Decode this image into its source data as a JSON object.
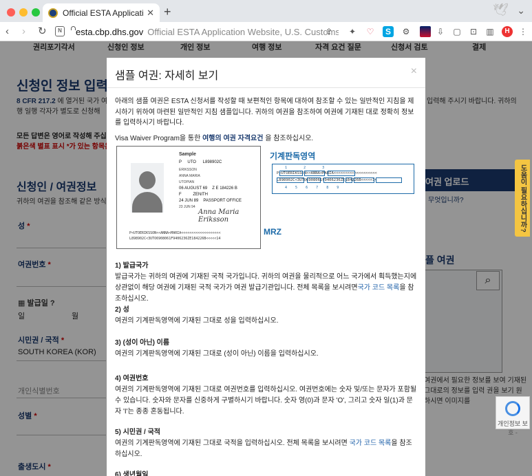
{
  "browser": {
    "tab_title": "Official ESTA Application Website",
    "tab_close": "✕",
    "new_tab": "+",
    "url_domain": "esta.cbp.dhs.gov",
    "url_title": "Official ESTA Application Website, U.S. Customs",
    "avatar_initial": "H",
    "icons": [
      "back-icon",
      "forward-icon",
      "reload-icon",
      "reader-icon",
      "lock-icon",
      "share-icon",
      "extensions-icon",
      "pocket-icon",
      "s-icon",
      "gear-icon",
      "flag-icon",
      "download-icon",
      "camera-icon",
      "screenshot-icon",
      "sidebar-icon",
      "profile-avatar",
      "more-icon"
    ]
  },
  "page": {
    "steps": [
      "권리포기각서",
      "신청인 정보",
      "개인 정보",
      "여행 정보",
      "자격 요건 질문",
      "신청서 검토",
      "결제"
    ],
    "title": "신청인 정보 입력",
    "cfr_prefix": "8 CFR 217.2",
    "cfr_text": "에 열거된 국가 여행 일행 각자가 별도로 신청해",
    "cfr_text_right": "입력해 주시기 바랍니다. 귀하의",
    "english_notice": "모든 답변은 영어로 작성해 주십시",
    "required_notice": "붉은색 별표 표시 *가 있는 항목은",
    "section_title": "신청인 / 여권정보",
    "section_note": "귀하의 여권을 참조해 같은 방식으",
    "fields": {
      "surname": "성",
      "passport_no": "여권번호",
      "issue_date": "발급일",
      "day": "일",
      "month": "월",
      "citizenship": "시민권 / 국적",
      "citizenship_value": "SOUTH KOREA (KOR)",
      "personal_id": "개인식별번호",
      "sex": "성별",
      "birth_city": "출생도시"
    },
    "upload_button": "여권 업로드",
    "upload_question": "무엇입니까?",
    "help_tab": "도움이 필요하십니까?",
    "sample_title": "플 여권",
    "sample_text": "여권에서 필요한 정보를 보여 기재된 그대로의 정보를 입력 권을 보기 원하시면 이미지를",
    "recaptcha": "개인정보 보호 -"
  },
  "modal": {
    "title": "샘플 여권: 자세히 보기",
    "close": "×",
    "intro": "아래의 샘플 여권은 ESTA 신청서를 작성할 때 보편적인 항목에 대하여 참조할 수 있는 일반적인 지침을 제시하기 위하여 마련된 일반적인 지침 샘플입니다. 귀하의 여권을 참조하여 여권에 기재된 대로 정확히 정보를 입력하시기 바랍니다.",
    "vw_prefix": "Visa Waiver Program을 통한 ",
    "vw_link": "여행의 여권 자격요건",
    "vw_suffix": " 을 참조하십시오.",
    "sample_card": {
      "sample_word": "Sample",
      "passport_label": "Passport/ Passport",
      "type": "P",
      "country": "UTO",
      "passport_no": "L898902C",
      "surname": "ERIKSSON",
      "given_names": "ANNA MARIA",
      "nationality": "UTOPIAN",
      "birth_date": "06 AUGUST 69",
      "personal_no": "Z E 184226 B",
      "sex": "F",
      "birth_place": "ZENITH",
      "issue_date": "24 JUN 89",
      "authority": "PASSPORT OFFICE",
      "expiry_date": "23 JUN 94",
      "signature": "Anna Maria Eriksson",
      "mrz_line1": "P<UTOERIKSSON<<ANNA<MARIA<<<<<<<<<<<<<<<<<<<",
      "mrz_line2": "L898902C<3UTO6908061F9406236ZE184226B<<<<<14"
    },
    "mrz_heading": "기계판독영역",
    "mrz_label": "MRZ",
    "mrz_digits_top": "1        2        3",
    "mrz_digits_bottom": "4    5    6    7    8    9",
    "sections": [
      {
        "title": "1) 발급국가",
        "text": "발급국가는 귀하의 여권에 기재된 국적 국가입니다. 귀하의 여권을 물리적으로 어느 국가에서 획득했는지에 상관없이 해당 여권에 기재된 국적 국가가 여권 발급기관입니다. 전체 목록을 보시려면",
        "link": "국가 코드 목록",
        "suffix": "을 참조하십시오."
      },
      {
        "title": "2) 성",
        "text": "여권의 기계판독영역에 기재된 그대로 성을 입력하십시오."
      },
      {
        "title": "3) (성이 아닌) 이름",
        "text": "여권의 기계판독영역에 기재된 그대로 (성이 아닌) 이름을 입력하십시오."
      },
      {
        "title": "4) 여권번호",
        "text": "여권의 기계판독영역에 기재된 그대로 여권번호를 입력하십시오. 여권번호에는 숫자 및/또는 문자가 포함될 수 있습니다. 숫자와 문자를 신중하게 구별하시기 바랍니다. 숫자 영(0)과 문자 'O', 그리고 숫자 일(1)과 문자 'I'는 종종 혼동됩니다."
      },
      {
        "title": "5) 시민권 / 국적",
        "text": "여권의 기계판독영역에 기재된 그대로 국적을 입력하십시오. 전체 목록을 보시려면 ",
        "link": "국가 코드 목록",
        "suffix": "을 참조하십시오."
      },
      {
        "title": "6) 생년월일",
        "text": ""
      }
    ]
  }
}
